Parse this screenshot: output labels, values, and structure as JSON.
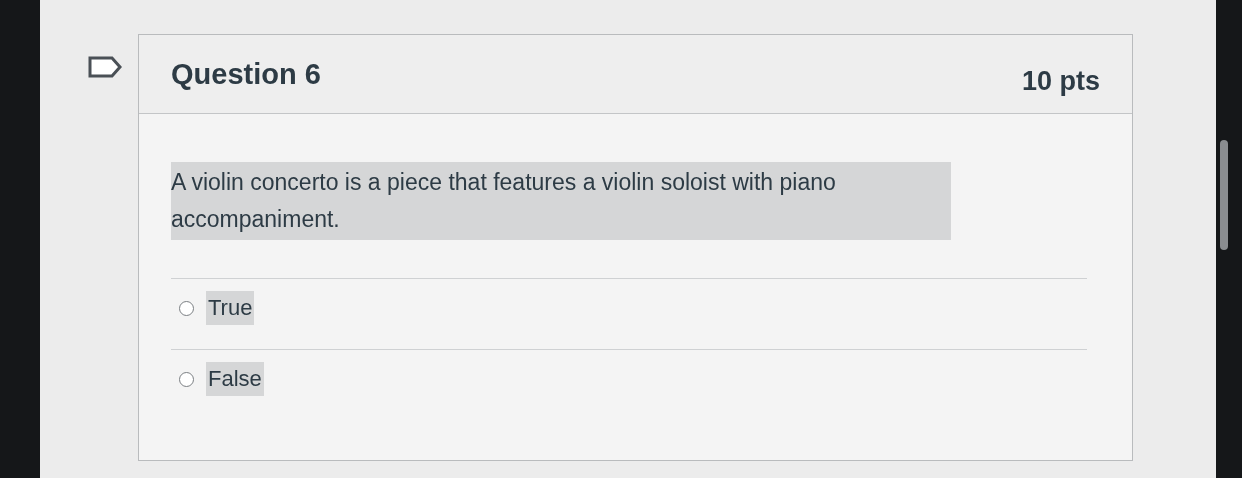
{
  "question": {
    "title": "Question 6",
    "points": "10 pts",
    "flagged": false,
    "text": "A violin concerto is a piece that features a violin soloist with piano accompaniment.",
    "highlighted": true,
    "answers": [
      {
        "label": "True",
        "selected": false,
        "highlighted": true
      },
      {
        "label": "False",
        "selected": false,
        "highlighted": true
      }
    ]
  }
}
